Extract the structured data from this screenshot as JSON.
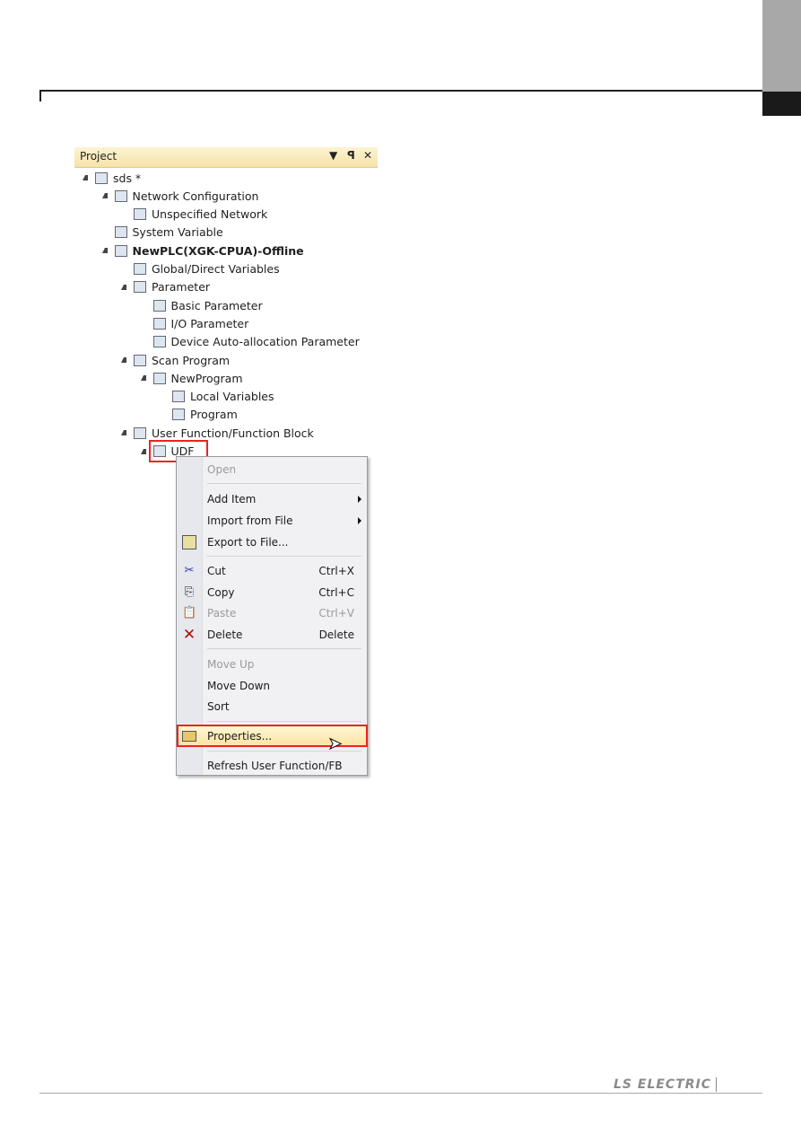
{
  "panel": {
    "title": "Project",
    "dropdown_icon": "triangle-down-icon",
    "pin_icon": "pin-icon",
    "close_icon": "close-icon"
  },
  "tree": [
    {
      "label": "sds *",
      "level": 0,
      "icon": "project-icon"
    },
    {
      "label": "Network Configuration",
      "level": 1,
      "icon": "network-icon"
    },
    {
      "label": "Unspecified Network",
      "level": 2,
      "icon": "plc-icon"
    },
    {
      "label": "System Variable",
      "level": 1,
      "icon": "system-variable-icon"
    },
    {
      "label": "NewPLC(XGK-CPUA)-Offline",
      "level": 1,
      "icon": "plc-icon",
      "bold": true
    },
    {
      "label": "Global/Direct Variables",
      "level": 2,
      "icon": "global-variable-icon"
    },
    {
      "label": "Parameter",
      "level": 2,
      "icon": "parameter-icon"
    },
    {
      "label": "Basic Parameter",
      "level": 3,
      "icon": "basic-parameter-icon"
    },
    {
      "label": "I/O Parameter",
      "level": 3,
      "icon": "io-parameter-icon"
    },
    {
      "label": "Device Auto-allocation Parameter",
      "level": 3,
      "icon": "device-parameter-icon"
    },
    {
      "label": "Scan Program",
      "level": 2,
      "icon": "scan-program-icon"
    },
    {
      "label": "NewProgram",
      "level": 3,
      "icon": "program-icon"
    },
    {
      "label": "Local Variables",
      "level": 4,
      "icon": "local-variables-icon"
    },
    {
      "label": "Program",
      "level": 4,
      "icon": "program-icon"
    },
    {
      "label": "User Function/Function Block",
      "level": 2,
      "icon": "user-function-icon"
    },
    {
      "label": "UDF",
      "level": 3,
      "icon": "udf-icon"
    }
  ],
  "menu": {
    "open": "Open",
    "add_item": "Add Item",
    "import": "Import from File",
    "export": "Export to File...",
    "cut": "Cut",
    "cut_sc": "Ctrl+X",
    "copy": "Copy",
    "copy_sc": "Ctrl+C",
    "paste": "Paste",
    "paste_sc": "Ctrl+V",
    "delete": "Delete",
    "delete_sc": "Delete",
    "move_up": "Move Up",
    "move_down": "Move Down",
    "sort": "Sort",
    "properties": "Properties...",
    "refresh": "Refresh User Function/FB"
  },
  "footer": {
    "logo": "LS ELECTRIC"
  }
}
